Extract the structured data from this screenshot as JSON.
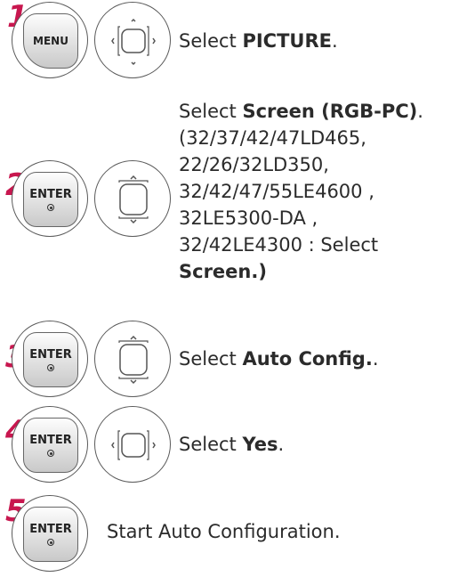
{
  "steps": [
    {
      "number": "1",
      "key": "MENU",
      "nav": "lr",
      "text": {
        "prefix": "Select ",
        "bold": "PICTURE",
        "suffix": "."
      }
    },
    {
      "number": "2",
      "key": "ENTER",
      "nav": "ud",
      "text": {
        "prefix": "Select ",
        "bold": "Screen (RGB-PC)",
        "suffix": ".",
        "lines": [
          "(32/37/42/47LD465,",
          "22/26/32LD350,",
          "32/42/47/55LE4600 ,",
          "32LE5300-DA ,",
          "32/42LE4300 : Select"
        ],
        "last_bold": "Screen.)"
      }
    },
    {
      "number": "3",
      "key": "ENTER",
      "nav": "ud",
      "text": {
        "prefix": "Select ",
        "bold": "Auto Config.",
        "suffix": "."
      }
    },
    {
      "number": "4",
      "key": "ENTER",
      "nav": "lr",
      "text": {
        "prefix": "Select ",
        "bold": "Yes",
        "suffix": "."
      }
    },
    {
      "number": "5",
      "key": "ENTER",
      "nav": "none",
      "text": {
        "prefix": "Start Auto Configuration.",
        "bold": "",
        "suffix": ""
      }
    }
  ],
  "colors": {
    "step_number": "#c8174f",
    "text": "#2b2b2b"
  },
  "icons": {
    "nav_lr": "nav-left-right-icon",
    "nav_ud": "nav-up-down-icon",
    "enter_dot": "enter-dot-icon"
  }
}
